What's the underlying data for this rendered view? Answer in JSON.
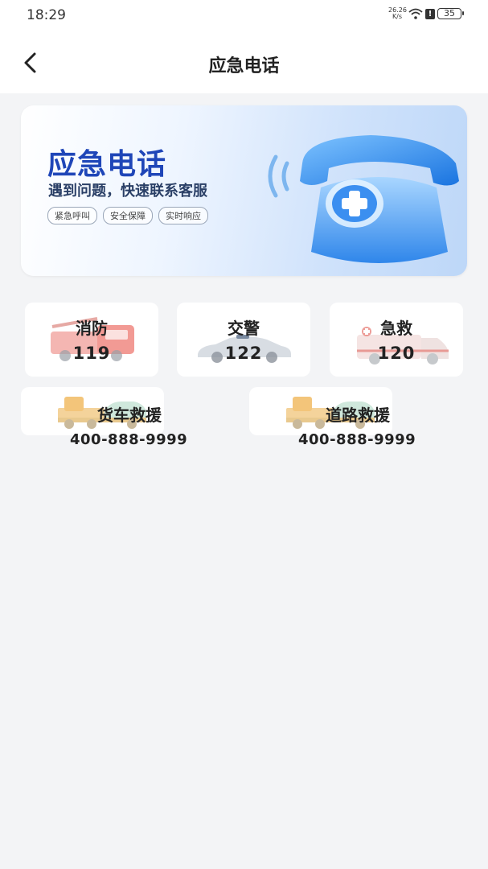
{
  "status_bar": {
    "time": "18:29",
    "net_speed_value": "26.2",
    "net_speed_unit": "K/s",
    "net_speed_suffix": "6",
    "battery": "35"
  },
  "header": {
    "title": "应急电话",
    "back_icon": "chevron-left-icon"
  },
  "banner": {
    "title": "应急电话",
    "subtitle": "遇到问题，快速联系客服",
    "tags": [
      "紧急呼叫",
      "安全保障",
      "实时响应"
    ],
    "illustration": "telephone-medical-cross-icon"
  },
  "services": [
    {
      "name": "消防",
      "number": "119",
      "icon": "fire-truck-icon"
    },
    {
      "name": "交警",
      "number": "122",
      "icon": "police-car-icon"
    },
    {
      "name": "急救",
      "number": "120",
      "icon": "ambulance-icon"
    }
  ],
  "rescue": [
    {
      "name": "货车救援",
      "number": "400-888-9999",
      "icon": "tow-truck-icon"
    },
    {
      "name": "道路救援",
      "number": "400-888-9999",
      "icon": "tow-truck-icon"
    }
  ],
  "colors": {
    "page_bg": "#f3f4f6",
    "banner_title": "#1f46b8",
    "card_bg": "#ffffff",
    "text": "#222222"
  }
}
